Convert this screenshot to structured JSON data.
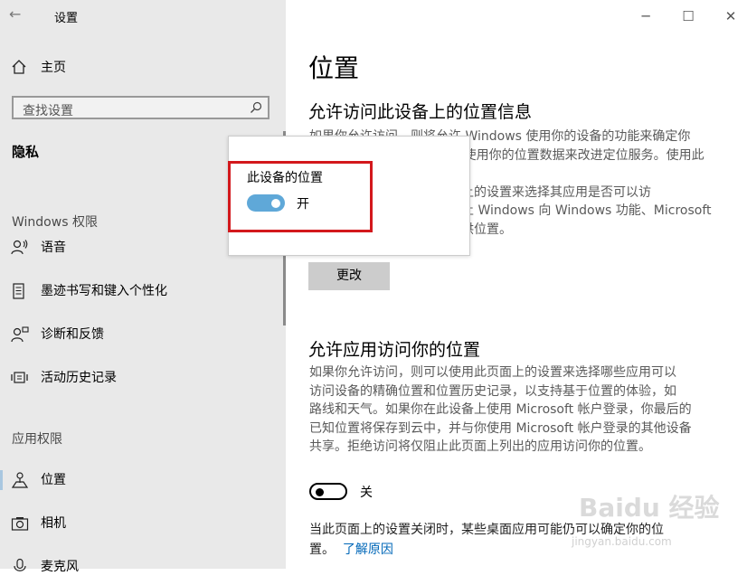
{
  "window": {
    "title": "设置",
    "back_glyph": "←",
    "min_glyph": "─",
    "max_glyph": "☐",
    "close_glyph": "✕"
  },
  "sidebar": {
    "home_label": "主页",
    "search_placeholder": "查找设置",
    "category": "隐私",
    "windows_permissions_header": "Windows 权限",
    "windows_items": [
      {
        "label": "语音",
        "icon": "speech-icon"
      },
      {
        "label": "墨迹书写和键入个性化",
        "icon": "inking-icon"
      },
      {
        "label": "诊断和反馈",
        "icon": "feedback-icon"
      },
      {
        "label": "活动历史记录",
        "icon": "activity-icon"
      }
    ],
    "app_permissions_header": "应用权限",
    "app_items": [
      {
        "label": "位置",
        "icon": "location-icon"
      },
      {
        "label": "相机",
        "icon": "camera-icon"
      },
      {
        "label": "麦克风",
        "icon": "microphone-icon"
      }
    ]
  },
  "main": {
    "page_title": "位置",
    "section1_title": "允许访问此设备上的位置信息",
    "section1_lines": [
      "如果你允许访问，则将允许 Windows 使用你的设备的功能来确定你",
      "的位置，并允许 Microsoft 使用你的位置数据来改进定位服务。使用此设",
      "备的人员将能够使用此页面上的设置来选择其应用是否可以访",
      "问位置信息。拒绝访问会阻止 Windows 向 Windows 功能、Microsoft",
      "应用和大多数第三方应用提供位置。"
    ],
    "change_button": "更改",
    "section2_title": "允许应用访问你的位置",
    "section2_lines": [
      "如果你允许访问，则可以使用此页面上的设置来选择哪些应用可以",
      "访问设备的精确位置和位置历史记录，以支持基于位置的体验，如",
      "路线和天气。如果你在此设备上使用 Microsoft 帐户登录，你最后的",
      "已知位置将保存到云中，并与你使用 Microsoft 帐户登录的其他设备",
      "共享。拒绝访问将仅阻止此页面上列出的应用访问你的位置。"
    ],
    "app_toggle_label": "关",
    "app_toggle_on": false,
    "footer_text": "当此页面上的设置关闭时，某些桌面应用可能仍可以确定你的位",
    "footer_text2": "置。",
    "footer_link": "了解原因"
  },
  "popup": {
    "title": "此设备的位置",
    "toggle_label": "开",
    "toggle_on": true
  },
  "colors": {
    "toggle_on": "#5fa8d8",
    "link": "#0067b8",
    "highlight": "#d3181c",
    "sidebar_bg": "#e9e9e9"
  },
  "watermark": {
    "text": "Baidu 经验",
    "subtext": "jingyan.baidu.com"
  }
}
